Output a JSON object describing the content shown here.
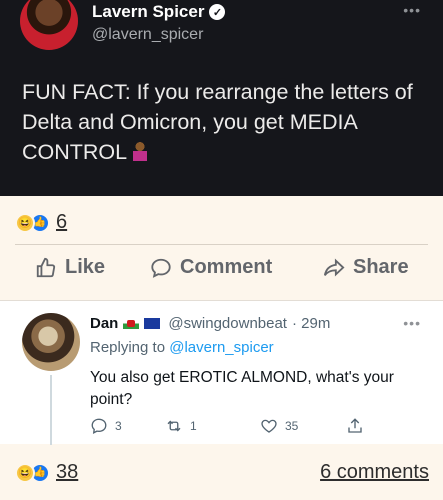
{
  "original_post": {
    "author_name": "Lavern Spicer",
    "author_handle": "@lavern_spicer",
    "verified_mark": "✓",
    "more_label": "•••",
    "text": "FUN FACT: If you rearrange the letters of Delta and Omicron, you get MEDIA CONTROL",
    "trailing_emoji": "person-shrugging-emoji"
  },
  "reactions_top": {
    "haha_icon": "😆",
    "like_icon": "👍",
    "count": "6"
  },
  "actions": {
    "like_label": "Like",
    "comment_label": "Comment",
    "share_label": "Share"
  },
  "reply_tweet": {
    "author_name": "Dan",
    "author_handle": "@swingdownbeat",
    "time": "· 29m",
    "more_label": "•••",
    "replying_prefix": "Replying to",
    "replying_handle": "@lavern_spicer",
    "text": "You also get EROTIC ALMOND, what's your point?",
    "reply_count": "3",
    "retweet_count": "1",
    "like_count": "35"
  },
  "reactions_bottom": {
    "haha_icon": "😆",
    "like_icon": "👍",
    "count": "38"
  },
  "comments_link": "6 comments",
  "colors": {
    "dark_bg": "#15161b",
    "cream_bg": "#fdf6ec",
    "link_blue": "#1d9bf0",
    "action_gray": "#63666b"
  }
}
